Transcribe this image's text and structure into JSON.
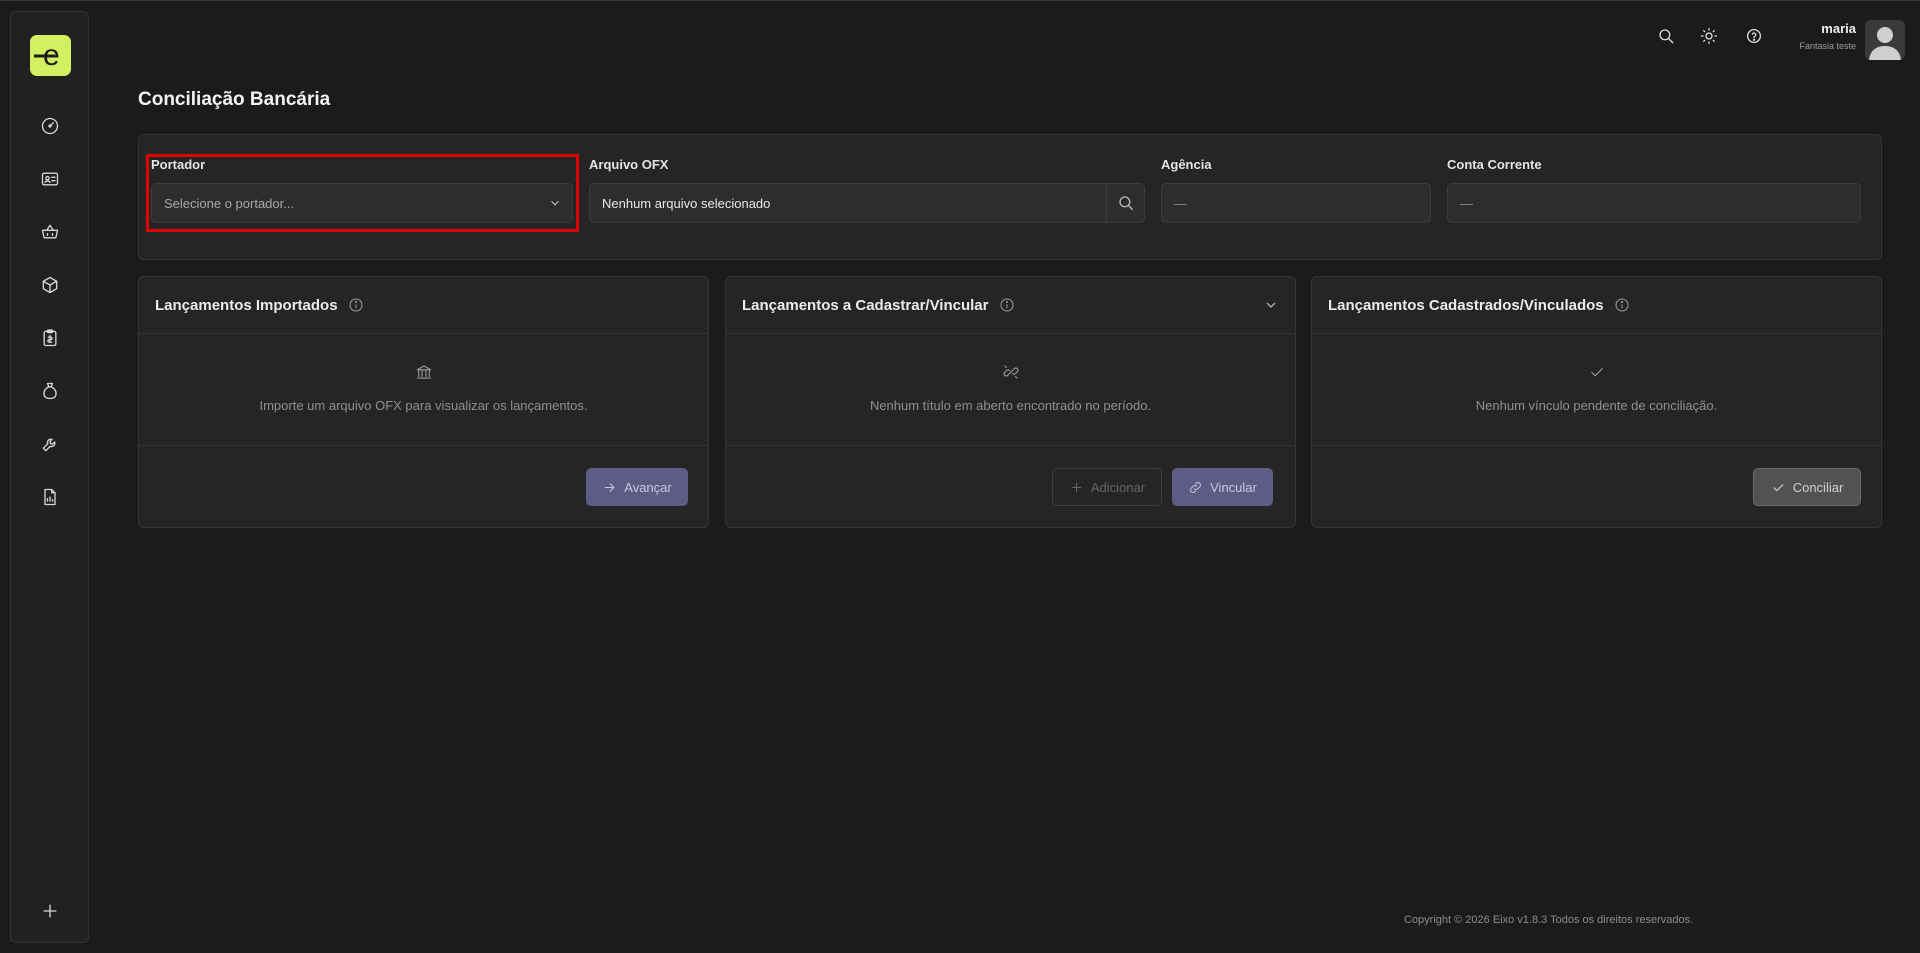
{
  "app": {
    "logo_letter": "e"
  },
  "sidebar": {
    "items": [
      {
        "icon": "gauge-icon"
      },
      {
        "icon": "id-card-icon"
      },
      {
        "icon": "basket-icon"
      },
      {
        "icon": "box-icon"
      },
      {
        "icon": "clipboard-icon"
      },
      {
        "icon": "money-bag-icon"
      },
      {
        "icon": "wrench-icon"
      },
      {
        "icon": "report-icon"
      }
    ],
    "add_icon": "plus-icon"
  },
  "header": {
    "user_name": "maria",
    "user_company": "Fantasia teste"
  },
  "page": {
    "title": "Conciliação Bancária"
  },
  "filters": {
    "portador_label": "Portador",
    "portador_placeholder": "Selecione o portador...",
    "ofx_label": "Arquivo OFX",
    "ofx_value": "Nenhum arquivo selecionado",
    "agencia_label": "Agência",
    "agencia_value": "—",
    "conta_label": "Conta Corrente",
    "conta_value": "—"
  },
  "panels": {
    "imported": {
      "title": "Lançamentos Importados",
      "empty_text": "Importe um arquivo OFX para visualizar os lançamentos.",
      "button": "Avançar"
    },
    "to_register": {
      "title": "Lançamentos a Cadastrar/Vincular",
      "empty_text": "Nenhum título em aberto encontrado no período.",
      "button_add": "Adicionar",
      "button_link": "Vincular"
    },
    "registered": {
      "title": "Lançamentos Cadastrados/Vinculados",
      "empty_text": "Nenhum vínculo pendente de conciliação.",
      "button": "Conciliar"
    }
  },
  "footer": {
    "text": "Copyright © 2026 Eixo v1.8.3 Todos os direitos reservados."
  },
  "colors": {
    "accent": "#d4f062",
    "primary_button": "#5e5b84",
    "highlight": "#e20000"
  }
}
